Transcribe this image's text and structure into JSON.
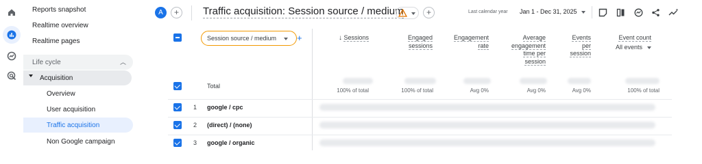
{
  "nav": {
    "items_top": [
      "Reports snapshot",
      "Realtime overview",
      "Realtime pages"
    ],
    "section_label": "Life cycle",
    "acquisition_label": "Acquisition",
    "sub_items": [
      "Overview",
      "User acquisition",
      "Traffic acquisition",
      "Non Google campaign"
    ],
    "active_item": "Traffic acquisition"
  },
  "header": {
    "avatar_letter": "A",
    "title": "Traffic acquisition: Session source / medium",
    "range_label": "Last calendar year",
    "range_value": "Jan 1 - Dec 31, 2025"
  },
  "table": {
    "dimension_label": "Session source / medium",
    "columns": [
      {
        "label": "Sessions",
        "sub": "100% of total"
      },
      {
        "label": "Engaged sessions",
        "sub": "100% of total"
      },
      {
        "label": "Engagement rate",
        "sub": "Avg 0%"
      },
      {
        "label": "Average engagement time per session",
        "sub": "Avg 0%"
      },
      {
        "label": "Events per session",
        "sub": "Avg 0%"
      },
      {
        "label": "Event count",
        "sub": "100% of total"
      }
    ],
    "event_filter": "All events",
    "total_label": "Total",
    "rows": [
      {
        "num": "1",
        "name": "google / cpc"
      },
      {
        "num": "2",
        "name": "(direct) / (none)"
      },
      {
        "num": "3",
        "name": "google / organic"
      }
    ]
  },
  "colors": {
    "accent": "#1a73e8",
    "warning": "#f29900"
  }
}
